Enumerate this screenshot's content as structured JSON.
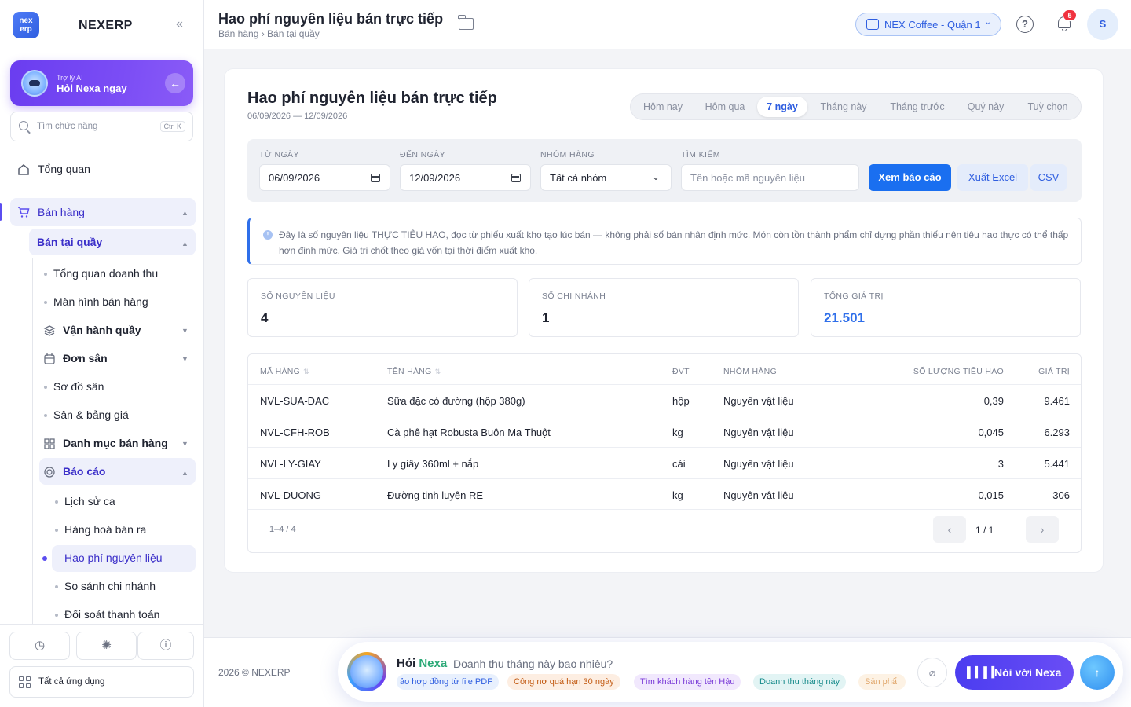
{
  "sidebar": {
    "logo_text": "nex erp",
    "brand": "NEXERP",
    "collapse": "«",
    "ai": {
      "small": "Trợ lý AI",
      "big": "Hỏi Nexa ngay"
    },
    "search": {
      "placeholder": "Tìm chức năng",
      "shortcut": "Ctrl K"
    },
    "overview": "Tổng quan",
    "sales": "Bán hàng",
    "counter_sales": "Bán tại quầy",
    "items": [
      {
        "label": "Tổng quan doanh thu",
        "icon": "dot"
      },
      {
        "label": "Màn hình bán hàng",
        "icon": "dot"
      },
      {
        "label": "Vận hành quầy",
        "icon": "layers-icon"
      },
      {
        "label": "Đơn sân",
        "icon": "calendar-icon"
      },
      {
        "label": "Sơ đồ sân",
        "icon": "dot"
      },
      {
        "label": "Sân & bảng giá",
        "icon": "dot"
      },
      {
        "label": "Danh mục bán hàng",
        "icon": "grid-icon"
      },
      {
        "label": "Báo cáo",
        "icon": "report-icon"
      }
    ],
    "report_items": [
      "Lịch sử ca",
      "Hàng hoá bán ra",
      "Hao phí nguyên liệu",
      "So sánh chi nhánh",
      "Đối soát thanh toán"
    ],
    "bottom_icons": [
      "history-icon",
      "bug-icon",
      "alert-icon"
    ],
    "all_apps": "Tất cả ứng dụng"
  },
  "header": {
    "title": "Hao phí nguyên liệu bán trực tiếp",
    "breadcrumb": "Bán hàng › Bán tại quầy",
    "branch": "NEX Coffee - Quận 1",
    "help": "?",
    "notifications": "5",
    "avatar": "S"
  },
  "report": {
    "title": "Hao phí nguyên liệu bán trực tiếp",
    "range": "06/09/2026 — 12/09/2026",
    "periods": [
      "Hôm nay",
      "Hôm qua",
      "7 ngày",
      "Tháng này",
      "Tháng trước",
      "Quý này",
      "Tuỳ chọn"
    ],
    "active_period": "7 ngày",
    "filters": {
      "from_label": "Từ ngày",
      "from_value": "06/09/2026",
      "to_label": "Đến ngày",
      "to_value": "12/09/2026",
      "group_label": "Nhóm hàng",
      "group_value": "Tất cả nhóm",
      "search_label": "Tìm kiếm",
      "search_placeholder": "Tên hoặc mã nguyên liệu"
    },
    "buttons": {
      "view": "Xem báo cáo",
      "excel": "Xuất Excel",
      "csv": "CSV"
    },
    "info": "Đây là số nguyên liệu THỰC TIÊU HAO, đọc từ phiếu xuất kho tạo lúc bán — không phải số bán nhân định mức. Món còn tồn thành phẩm chỉ dựng phần thiếu nên tiêu hao thực có thể thấp hơn định mức. Giá trị chốt theo giá vốn tại thời điểm xuất kho.",
    "stats": [
      {
        "label": "Số nguyên liệu",
        "value": "4"
      },
      {
        "label": "Số chi nhánh",
        "value": "1"
      },
      {
        "label": "Tổng giá trị",
        "value": "21.501"
      }
    ],
    "columns": [
      "Mã hàng",
      "Tên hàng",
      "ĐVT",
      "Nhóm hàng",
      "Số lượng tiêu hao",
      "Giá trị"
    ],
    "rows": [
      {
        "code": "NVL-SUA-DAC",
        "name": "Sữa đặc có đường (hộp 380g)",
        "unit": "hộp",
        "group": "Nguyên vật liệu",
        "qty": "0,39",
        "value": "9.461"
      },
      {
        "code": "NVL-CFH-ROB",
        "name": "Cà phê hạt Robusta Buôn Ma Thuột",
        "unit": "kg",
        "group": "Nguyên vật liệu",
        "qty": "0,045",
        "value": "6.293"
      },
      {
        "code": "NVL-LY-GIAY",
        "name": "Ly giấy 360ml + nắp",
        "unit": "cái",
        "group": "Nguyên vật liệu",
        "qty": "3",
        "value": "5.441"
      },
      {
        "code": "NVL-DUONG",
        "name": "Đường tinh luyện RE",
        "unit": "kg",
        "group": "Nguyên vật liệu",
        "qty": "0,015",
        "value": "306"
      }
    ],
    "pagination": {
      "info": "1–4 / 4",
      "page": "1 / 1",
      "prev": "‹",
      "next": "›"
    }
  },
  "footer": {
    "copyright": "2026 © NEXERP",
    "nexa_prefix": "Hỏi",
    "nexa_name": "Nexa",
    "question": "Doanh thu tháng này bao nhiêu?",
    "chips": [
      "ảo hợp đồng từ file PDF",
      "Công nợ quá hạn 30 ngày",
      "Tìm khách hàng tên Hậu",
      "Doanh thu tháng này",
      "Sản phẩ"
    ],
    "talk": "Nói với Nexa",
    "colors": {
      "accent": "#1a6ff0",
      "ai": "#6a3df0"
    }
  }
}
